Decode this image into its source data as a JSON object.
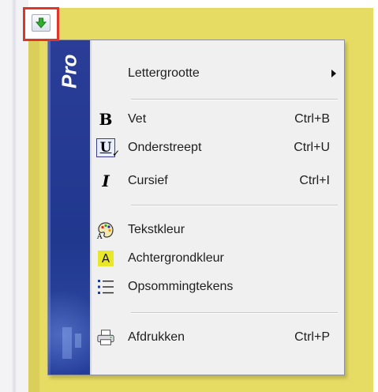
{
  "menu": {
    "brand": "Pro",
    "items": [
      {
        "label": "Lettergrootte",
        "shortcut": "",
        "icon": "none",
        "has_submenu": true
      },
      {
        "label": "Vet",
        "shortcut": "Ctrl+B",
        "icon": "bold-icon"
      },
      {
        "label": "Onderstreept",
        "shortcut": "Ctrl+U",
        "icon": "underline-icon"
      },
      {
        "label": "Cursief",
        "shortcut": "Ctrl+I",
        "icon": "italic-icon"
      },
      {
        "label": "Tekstkleur",
        "shortcut": "",
        "icon": "palette-icon"
      },
      {
        "label": "Achtergrondkleur",
        "shortcut": "",
        "icon": "highlight-icon"
      },
      {
        "label": "Opsommingtekens",
        "shortcut": "",
        "icon": "bullet-list-icon"
      },
      {
        "label": "Afdrukken",
        "shortcut": "Ctrl+P",
        "icon": "printer-icon"
      }
    ]
  },
  "trigger": {
    "icon": "green-down-arrow-icon"
  },
  "colors": {
    "banner": "#21388f",
    "trigger_border": "#e0362a",
    "background": "#e7dc63",
    "menu_bg": "#f0f0f0",
    "highlight": "#e9e72a"
  }
}
